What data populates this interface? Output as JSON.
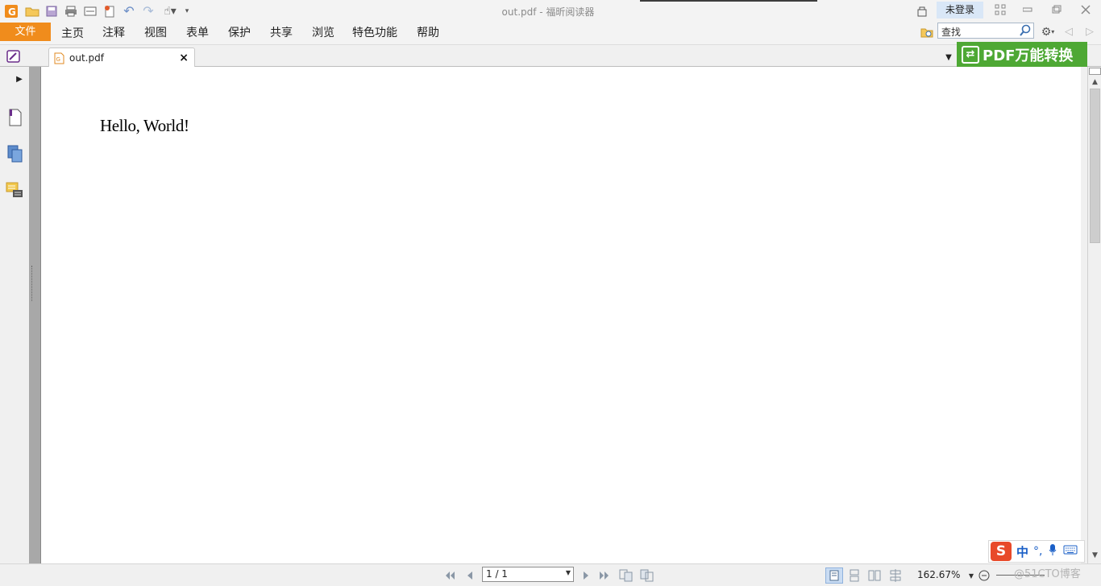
{
  "window": {
    "title": "out.pdf - 福昕阅读器",
    "login_label": "未登录"
  },
  "menubar": {
    "file_label": "文件",
    "items": [
      "主页",
      "注释",
      "视图",
      "表单",
      "保护",
      "共享",
      "浏览",
      "特色功能",
      "帮助"
    ],
    "search_value": "查找"
  },
  "tabs": {
    "active_tab_label": "out.pdf",
    "close_glyph": "×"
  },
  "promo": {
    "convert_label": "PDF万能转换"
  },
  "document": {
    "content_text": "Hello, World!"
  },
  "statusbar": {
    "page_indicator": "1 / 1",
    "zoom_level": "162.67%"
  },
  "ime": {
    "logo_letter": "S",
    "mode_label": "中",
    "punct_label": "°,"
  },
  "watermark": {
    "text": "@51CTO博客"
  },
  "colors": {
    "file_button": "#f08c1c",
    "convert_banner": "#4ea834",
    "login_bg": "#d9e7f7"
  }
}
